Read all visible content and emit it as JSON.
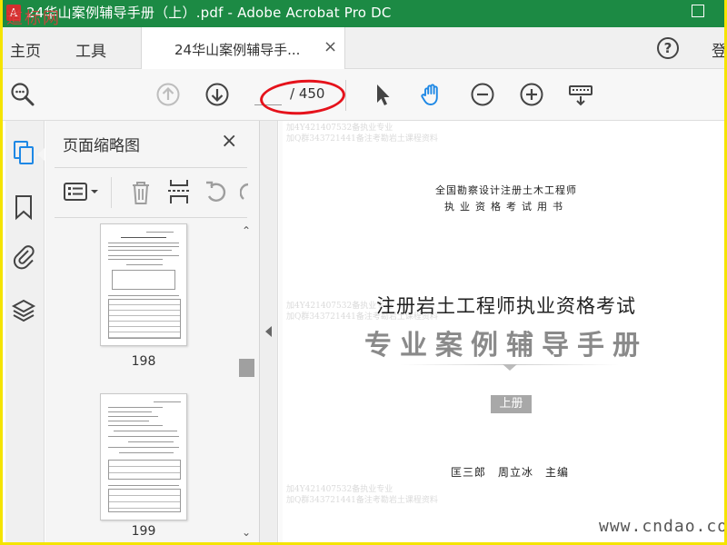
{
  "window": {
    "title": "24华山案例辅导手册（上）.pdf - Adobe Acrobat Pro DC",
    "watermark_corner": "道标网"
  },
  "menu": {
    "home": "主页",
    "tools": "工具",
    "tab_label": "24华山案例辅导手...",
    "tab_close": "×",
    "help": "?",
    "login": "登"
  },
  "toolbar": {
    "page_current": "",
    "page_total": "/ 450"
  },
  "panel": {
    "title": "页面缩略图",
    "close": "×",
    "thumbnails": [
      {
        "label": "198"
      },
      {
        "label": "199"
      }
    ]
  },
  "document": {
    "line1": "全国勘察设计注册土木工程师",
    "line2": "执业资格考试用书",
    "title1": "注册岩土工程师执业资格考试",
    "title2": "专业案例辅导手册",
    "volume": "上册",
    "authors": "匡三郎　周立冰　主编",
    "faint_watermarks": [
      "加4Y421407532备执业专业",
      "加Q群343721441备注考勘岩土课程资料",
      "加4Y421407532备执业专业",
      "加Q群343721441备注考勘岩土课程资料",
      "加4Y421407532备执业专业",
      "加Q群343721441备注考勘岩土课程资料"
    ],
    "site_watermark": "www.cndao.com"
  },
  "colors": {
    "titlebar": "#1c8a44",
    "accent_blue": "#1e88e5",
    "annotation_red": "#e5121b",
    "frame_yellow": "#f5e400"
  }
}
